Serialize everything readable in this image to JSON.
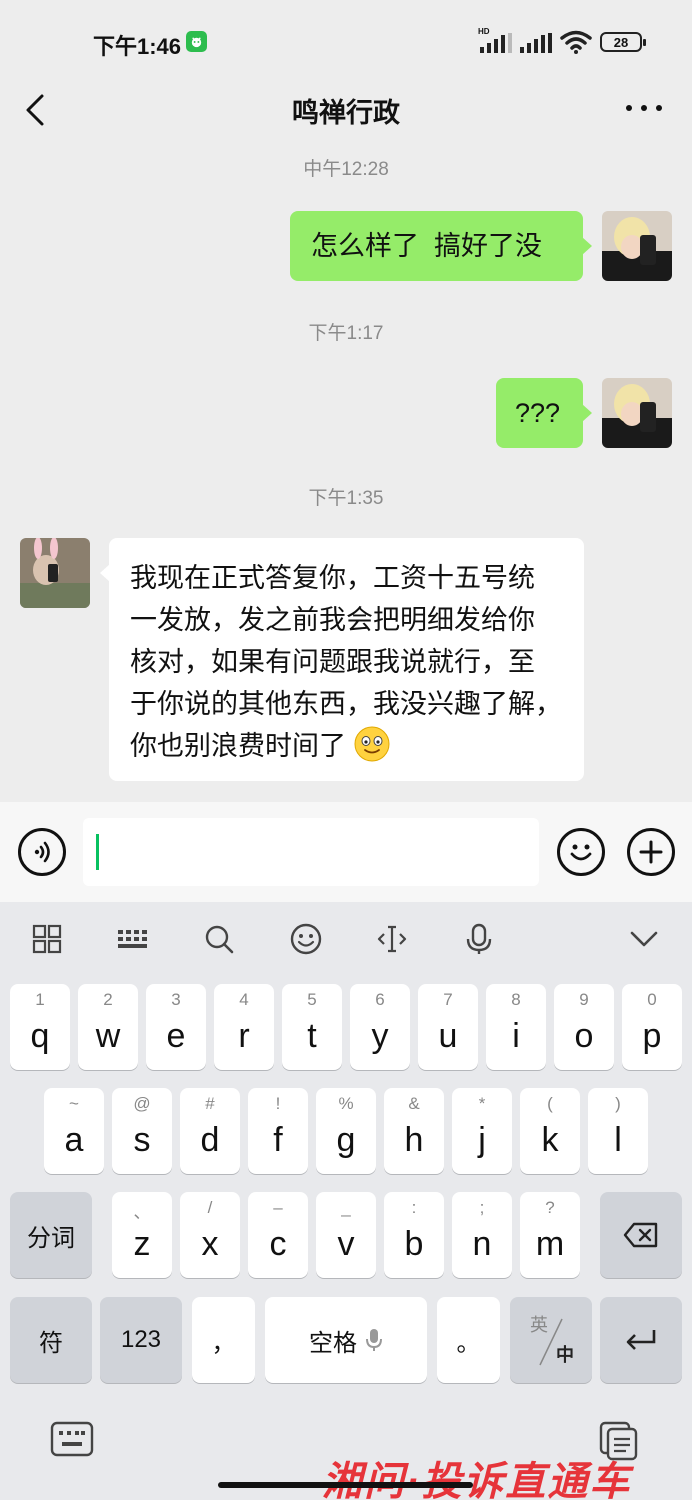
{
  "status": {
    "time": "下午1:46",
    "battery": "28",
    "network": "HD"
  },
  "header": {
    "title": "鸣禅行政"
  },
  "messages": [
    {
      "type": "time",
      "text": "中午12:28"
    },
    {
      "type": "msg",
      "from": "me",
      "text": "怎么样了  搞好了没"
    },
    {
      "type": "time",
      "text": "下午1:17"
    },
    {
      "type": "msg",
      "from": "me",
      "text": "???"
    },
    {
      "type": "time",
      "text": "下午1:35"
    },
    {
      "type": "msg",
      "from": "other",
      "lines": [
        "我现在正式答复你，工资十五号统",
        "一发放，发之前我会把明细发给你",
        "核对，如果有问题跟我说就行，至",
        "于你说的其他东西，我没兴趣了解，",
        "你也别浪费时间了"
      ],
      "emoji": "smile-emoji"
    }
  ],
  "keyboard": {
    "row1": [
      {
        "sub": "1",
        "key": "q"
      },
      {
        "sub": "2",
        "key": "w"
      },
      {
        "sub": "3",
        "key": "e"
      },
      {
        "sub": "4",
        "key": "r"
      },
      {
        "sub": "5",
        "key": "t"
      },
      {
        "sub": "6",
        "key": "y"
      },
      {
        "sub": "7",
        "key": "u"
      },
      {
        "sub": "8",
        "key": "i"
      },
      {
        "sub": "9",
        "key": "o"
      },
      {
        "sub": "0",
        "key": "p"
      }
    ],
    "row2": [
      {
        "sub": "~",
        "key": "a"
      },
      {
        "sub": "@",
        "key": "s"
      },
      {
        "sub": "#",
        "key": "d"
      },
      {
        "sub": "!",
        "key": "f"
      },
      {
        "sub": "%",
        "key": "g"
      },
      {
        "sub": "&",
        "key": "h"
      },
      {
        "sub": "*",
        "key": "j"
      },
      {
        "sub": "(",
        "key": "k"
      },
      {
        "sub": ")",
        "key": "l"
      }
    ],
    "row3": [
      {
        "sub": "、",
        "key": "z"
      },
      {
        "sub": "/",
        "key": "x"
      },
      {
        "sub": "–",
        "key": "c"
      },
      {
        "sub": "_",
        "key": "v"
      },
      {
        "sub": ":",
        "key": "b"
      },
      {
        "sub": ";",
        "key": "n"
      },
      {
        "sub": "?",
        "key": "m"
      }
    ],
    "fenci": "分词",
    "fu": "符",
    "num": "123",
    "comma": "，",
    "space": "空格",
    "period": "。",
    "lang_top": "英",
    "lang_bottom": "中"
  },
  "watermark": "湘问·投诉直通车"
}
